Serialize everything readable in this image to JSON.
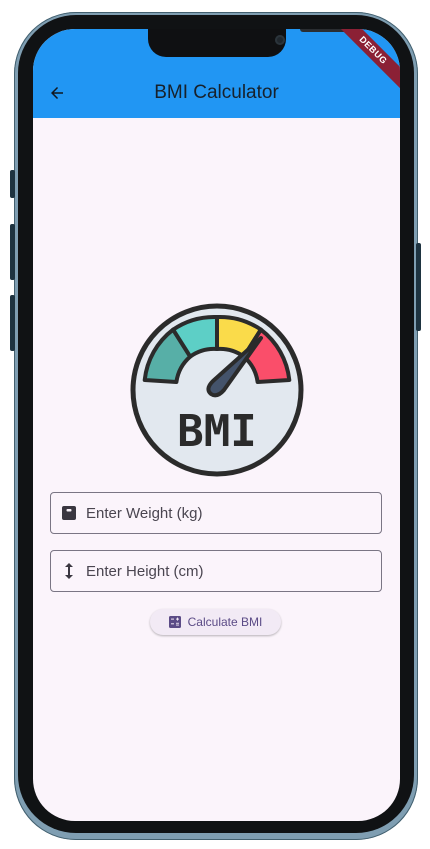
{
  "appbar": {
    "title": "BMI Calculator",
    "back_icon": "arrow-back-icon",
    "color": "#2196F3"
  },
  "debug_banner": {
    "label": "DEBUG",
    "color": "#8B2035"
  },
  "logo": {
    "text": "BMI",
    "segment_colors": [
      "#57AFA7",
      "#5DCFC6",
      "#FADB4A",
      "#FA4E6A"
    ]
  },
  "form": {
    "weight": {
      "placeholder": "Enter Weight (kg)",
      "value": "",
      "icon": "scale-icon"
    },
    "height": {
      "placeholder": "Enter Height (cm)",
      "value": "",
      "icon": "height-arrows-icon"
    }
  },
  "calculate_button": {
    "label": "Calculate BMI",
    "icon": "calculate-icon",
    "color": "#5B4B86"
  },
  "colors": {
    "background": "#FBF4FB",
    "text": "#17212B"
  }
}
